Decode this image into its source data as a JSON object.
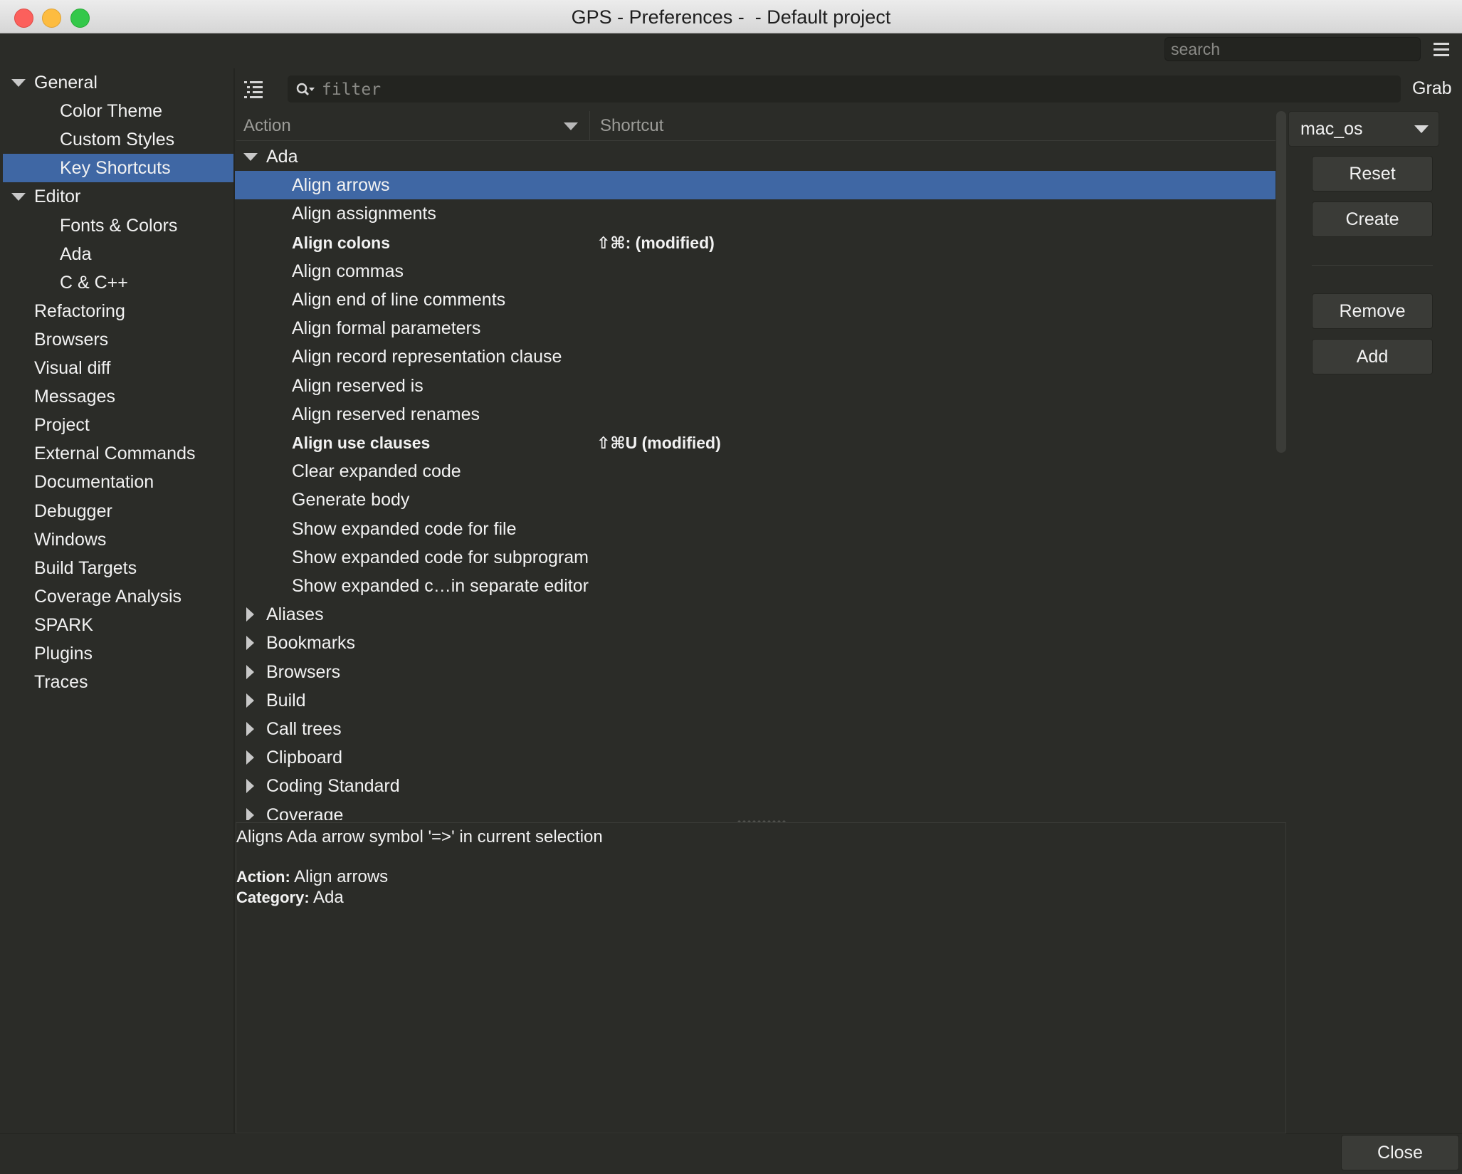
{
  "window": {
    "title": "GPS - Preferences -  - Default project"
  },
  "global_search": {
    "placeholder": "search"
  },
  "sidebar": {
    "items": [
      {
        "label": "General",
        "expandable": true
      },
      {
        "label": "Color Theme"
      },
      {
        "label": "Custom Styles"
      },
      {
        "label": "Key Shortcuts",
        "selected": true
      },
      {
        "label": "Editor",
        "expandable": true
      },
      {
        "label": "Fonts & Colors"
      },
      {
        "label": "Ada"
      },
      {
        "label": "C & C++"
      },
      {
        "label": "Refactoring"
      },
      {
        "label": "Browsers"
      },
      {
        "label": "Visual diff"
      },
      {
        "label": "Messages"
      },
      {
        "label": "Project"
      },
      {
        "label": "External Commands"
      },
      {
        "label": "Documentation"
      },
      {
        "label": "Debugger"
      },
      {
        "label": "Windows"
      },
      {
        "label": "Build Targets"
      },
      {
        "label": "Coverage Analysis"
      },
      {
        "label": "SPARK"
      },
      {
        "label": "Plugins"
      },
      {
        "label": "Traces"
      }
    ]
  },
  "toolbar": {
    "filter_placeholder": "filter",
    "grab_label": "Grab"
  },
  "columns": {
    "action": "Action",
    "shortcut": "Shortcut"
  },
  "tree": {
    "rows": [
      {
        "label": "Ada",
        "kind": "category-open"
      },
      {
        "label": "Align arrows",
        "kind": "action",
        "selected": true
      },
      {
        "label": "Align assignments",
        "kind": "action"
      },
      {
        "label": "Align colons",
        "kind": "action",
        "modified": true,
        "shortcut": "⇧⌘: (modified)"
      },
      {
        "label": "Align commas",
        "kind": "action"
      },
      {
        "label": "Align end of line comments",
        "kind": "action"
      },
      {
        "label": "Align formal parameters",
        "kind": "action"
      },
      {
        "label": "Align record representation clause",
        "kind": "action"
      },
      {
        "label": "Align reserved is",
        "kind": "action"
      },
      {
        "label": "Align reserved renames",
        "kind": "action"
      },
      {
        "label": "Align use clauses",
        "kind": "action",
        "modified": true,
        "shortcut": "⇧⌘U (modified)"
      },
      {
        "label": "Clear expanded code",
        "kind": "action"
      },
      {
        "label": "Generate body",
        "kind": "action"
      },
      {
        "label": "Show expanded code for file",
        "kind": "action"
      },
      {
        "label": "Show expanded code for subprogram",
        "kind": "action"
      },
      {
        "label": "Show expanded c…in separate editor",
        "kind": "action"
      },
      {
        "label": "Aliases",
        "kind": "category-closed"
      },
      {
        "label": "Bookmarks",
        "kind": "category-closed"
      },
      {
        "label": "Browsers",
        "kind": "category-closed"
      },
      {
        "label": "Build",
        "kind": "category-closed"
      },
      {
        "label": "Call trees",
        "kind": "category-closed"
      },
      {
        "label": "Clipboard",
        "kind": "category-closed"
      },
      {
        "label": "Coding Standard",
        "kind": "category-closed"
      },
      {
        "label": "Coverage",
        "kind": "category-closed"
      }
    ]
  },
  "description": {
    "text": "Aligns Ada arrow symbol '=>' in current selection",
    "action_key": "Action:",
    "action_value": " Align arrows",
    "category_key": "Category:",
    "category_value": " Ada"
  },
  "right_panel": {
    "scheme": "mac_os",
    "reset_label": "Reset",
    "create_label": "Create",
    "remove_label": "Remove",
    "add_label": "Add"
  },
  "footer": {
    "close_label": "Close"
  },
  "colors": {
    "selection": "#3f67a4",
    "background": "#2b2c28",
    "input_background": "#232420"
  }
}
